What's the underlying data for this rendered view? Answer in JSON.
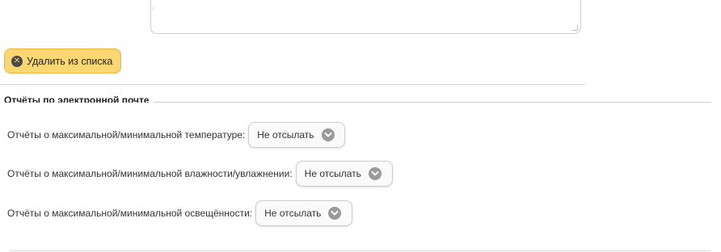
{
  "remove_button": {
    "label": "Удалить из списка",
    "icon": "close-circle-icon"
  },
  "email_reports": {
    "legend": "Отчёты по электронной почте",
    "rows": [
      {
        "label": "Отчёты о максимальной/минимальной температуре:",
        "value": "Не отсылать"
      },
      {
        "label": "Отчёты о максимальной/минимальной влажности/увлажнении:",
        "value": "Не отсылать"
      },
      {
        "label": "Отчёты о максимальной/минимальной освещённости:",
        "value": "Не отсылать"
      }
    ]
  },
  "colors": {
    "button_bg": "#fbd774",
    "button_border": "#e7b73e",
    "chevron_bg": "#9a9a9a"
  }
}
